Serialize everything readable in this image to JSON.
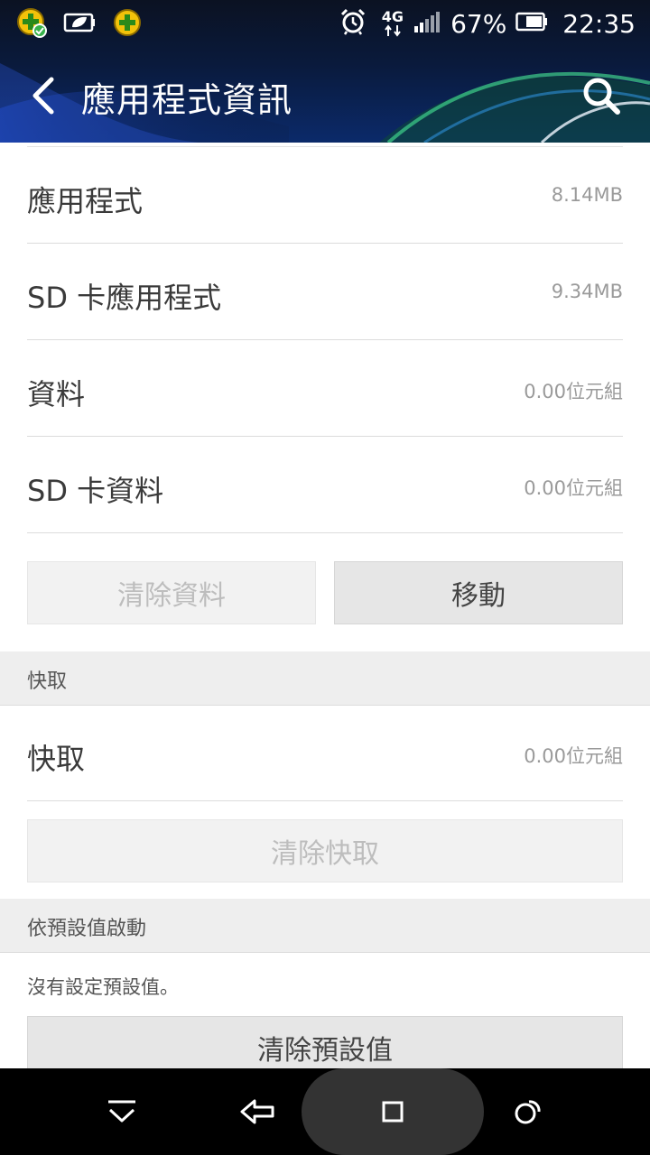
{
  "status_bar": {
    "network_type": "4G",
    "battery_percent": "67%",
    "time": "22:35"
  },
  "header": {
    "title": "應用程式資訊"
  },
  "storage": {
    "rows": [
      {
        "label": "應用程式",
        "value": "8.14MB"
      },
      {
        "label": "SD 卡應用程式",
        "value": "9.34MB"
      },
      {
        "label": "資料",
        "value": "0.00位元組"
      },
      {
        "label": "SD 卡資料",
        "value": "0.00位元組"
      }
    ],
    "clear_data_label": "清除資料",
    "move_label": "移動"
  },
  "cache": {
    "section_title": "快取",
    "row_label": "快取",
    "row_value": "0.00位元組",
    "clear_cache_label": "清除快取"
  },
  "defaults": {
    "section_title": "依預設值啟動",
    "info": "沒有設定預設值。",
    "clear_defaults_label": "清除預設值"
  },
  "colors": {
    "header_bg": "#0a1a3c",
    "nav_bg": "#000000",
    "disabled_text": "#bdbdbd"
  }
}
